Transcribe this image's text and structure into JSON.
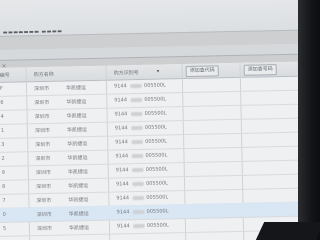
{
  "window": {
    "title": "▬▬▬▬▬▬▬ ▬▬▬▬"
  },
  "grid": {
    "columns": [
      "编号",
      "购方名称",
      "",
      "购方识别号",
      "添加查代码",
      "添加查号码"
    ],
    "rows": [
      {
        "id": "F",
        "name": "深圳市",
        "agent": "华凯捷运",
        "tax": "9144",
        "tail": "005500L"
      },
      {
        "id": "6",
        "name": "深圳市",
        "agent": "华凯捷运",
        "tax": "9144",
        "tail": "005500L"
      },
      {
        "id": "4",
        "name": "深圳市",
        "agent": "华凯捷运",
        "tax": "9144",
        "tail": "005500L"
      },
      {
        "id": "1",
        "name": "深圳市",
        "agent": "华凯捷运",
        "tax": "9144",
        "tail": "005500L"
      },
      {
        "id": "3",
        "name": "深圳市",
        "agent": "华凯捷运",
        "tax": "9144",
        "tail": "005500L"
      },
      {
        "id": "2",
        "name": "深圳市",
        "agent": "华凯捷运",
        "tax": "9144",
        "tail": "005500L"
      },
      {
        "id": "9",
        "name": "深圳市",
        "agent": "华凯捷运",
        "tax": "9144",
        "tail": "005500L"
      },
      {
        "id": "8",
        "name": "深圳市",
        "agent": "华凯捷运",
        "tax": "9144",
        "tail": "005500L"
      },
      {
        "id": "7",
        "name": "深圳市",
        "agent": "华凯捷运",
        "tax": "9144",
        "tail": "005500L"
      },
      {
        "id": "0",
        "name": "深圳市",
        "agent": "华凯捷运",
        "tax": "9144",
        "tail": "005500L"
      },
      {
        "id": "5",
        "name": "深圳市",
        "agent": "华凯捷运",
        "tax": "9144",
        "tail": "005500L"
      }
    ]
  },
  "icons": {
    "close": "close-icon",
    "sort": "sort-icon"
  },
  "colors": {
    "grid_bg": "#eef0f1",
    "header_bg": "#dcdfe2",
    "selected_row": "#d9e6f3",
    "bezel": "#141518"
  }
}
